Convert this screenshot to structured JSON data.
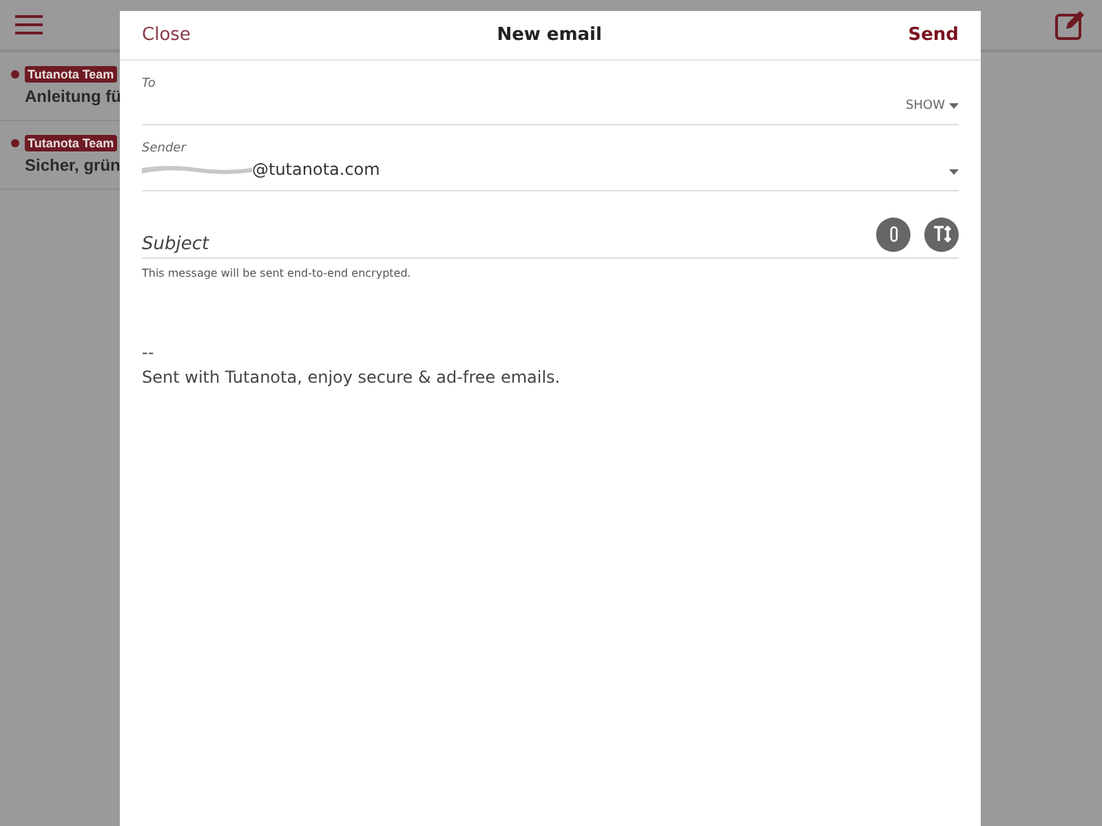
{
  "mail_list": [
    {
      "sender_badge": "Tutanota Team",
      "subject": "Anleitung fü",
      "unread": true
    },
    {
      "sender_badge": "Tutanota Team",
      "subject": "Sicher, grün",
      "unread": true
    }
  ],
  "dialog": {
    "close": "Close",
    "title": "New email",
    "send": "Send",
    "to": {
      "label": "To",
      "toggle": "SHOW"
    },
    "sender": {
      "label": "Sender",
      "value": "@tutanota.com"
    },
    "subject": {
      "placeholder": "Subject"
    },
    "encryption_note": "This message will be sent end-to-end encrypted.",
    "body": [
      "--",
      "Sent with Tutanota, enjoy secure & ad-free emails."
    ]
  }
}
